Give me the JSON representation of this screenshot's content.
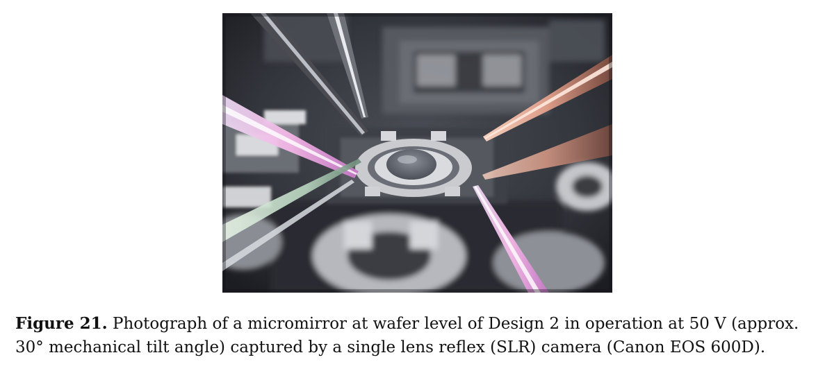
{
  "figure": {
    "label": "Figure 21.",
    "caption": "Photograph of a micromirror at wafer level of Design 2 in operation at 50 V (approx. 30° mechanical tilt angle) captured by a single lens reflex (SLR) camera (Canon EOS 600D)."
  }
}
